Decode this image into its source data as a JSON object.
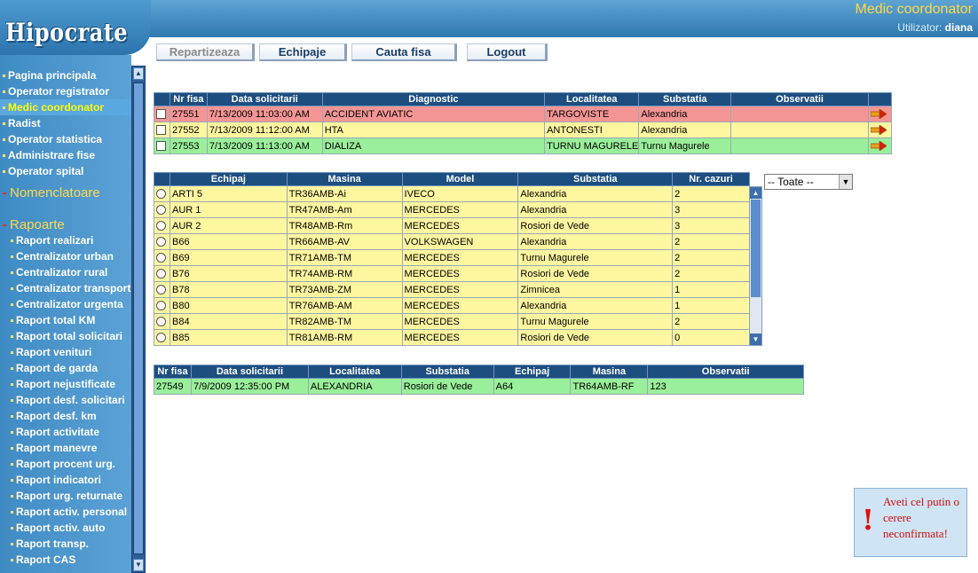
{
  "app": {
    "logo": "Hipocrate",
    "role": "Medic coordonator",
    "user_label": "Utilizator:",
    "user_name": "diana"
  },
  "toolbar": {
    "repartizeaza": "Repartizeaza",
    "echipaje": "Echipaje",
    "cauta_fisa": "Cauta fisa",
    "logout": "Logout"
  },
  "sidebar": {
    "items": [
      "Pagina principala",
      "Operator registrator",
      "Medic coordonator",
      "Radist",
      "Operator statistica",
      "Administrare fise",
      "Operator spital"
    ],
    "active_index": 2,
    "section_nomenclatoare": "Nomenclatoare",
    "section_rapoarte": "Rapoarte",
    "reports": [
      "Raport realizari",
      "Centralizator urban",
      "Centralizator rural",
      "Centralizator transport",
      "Centralizator urgenta",
      "Raport total KM",
      "Raport total solicitari",
      "Raport venituri",
      "Raport de garda",
      "Raport nejustificate",
      "Raport desf. solicitari",
      "Raport desf. km",
      "Raport activitate",
      "Raport manevre",
      "Raport procent urg.",
      "Raport indicatori",
      "Raport urg. returnate",
      "Raport activ. personal",
      "Raport activ. auto",
      "Raport transp.",
      "Raport CAS"
    ]
  },
  "requests": {
    "headers": [
      "",
      "Nr fisa",
      "Data solicitarii",
      "Diagnostic",
      "Localitatea",
      "Substatia",
      "Observatii",
      ""
    ],
    "rows": [
      {
        "nr": "27551",
        "data": "7/13/2009 11:03:00 AM",
        "diag": "ACCIDENT AVIATIC",
        "loc": "TARGOVISTE",
        "sub": "Alexandria",
        "obs": "",
        "color": "#f49595"
      },
      {
        "nr": "27552",
        "data": "7/13/2009 11:12:00 AM",
        "diag": "HTA",
        "loc": "ANTONESTI",
        "sub": "Alexandria",
        "obs": "",
        "color": "#fff6a0"
      },
      {
        "nr": "27553",
        "data": "7/13/2009 11:13:00 AM",
        "diag": "DIALIZA",
        "loc": "TURNU MAGURELE",
        "sub": "Turnu Magurele",
        "obs": "",
        "color": "#9aef9a"
      }
    ]
  },
  "crews": {
    "headers": [
      "",
      "Echipaj",
      "Masina",
      "Model",
      "Substatia",
      "Nr. cazuri"
    ],
    "filter_value": "-- Toate --",
    "rows": [
      {
        "echipaj": "ARTI 5",
        "masina": "TR36AMB-Ai",
        "model": "IVECO",
        "sub": "Alexandria",
        "nr": "2"
      },
      {
        "echipaj": "AUR 1",
        "masina": "TR47AMB-Am",
        "model": "MERCEDES",
        "sub": "Alexandria",
        "nr": "3"
      },
      {
        "echipaj": "AUR 2",
        "masina": "TR48AMB-Rm",
        "model": "MERCEDES",
        "sub": "Rosiori de Vede",
        "nr": "3"
      },
      {
        "echipaj": "B66",
        "masina": "TR66AMB-AV",
        "model": "VOLKSWAGEN",
        "sub": "Alexandria",
        "nr": "2"
      },
      {
        "echipaj": "B69",
        "masina": "TR71AMB-TM",
        "model": "MERCEDES",
        "sub": "Turnu Magurele",
        "nr": "2"
      },
      {
        "echipaj": "B76",
        "masina": "TR74AMB-RM",
        "model": "MERCEDES",
        "sub": "Rosiori de Vede",
        "nr": "2"
      },
      {
        "echipaj": "B78",
        "masina": "TR73AMB-ZM",
        "model": "MERCEDES",
        "sub": "Zimnicea",
        "nr": "1"
      },
      {
        "echipaj": "B80",
        "masina": "TR76AMB-AM",
        "model": "MERCEDES",
        "sub": "Alexandria",
        "nr": "1"
      },
      {
        "echipaj": "B84",
        "masina": "TR82AMB-TM",
        "model": "MERCEDES",
        "sub": "Turnu Magurele",
        "nr": "2"
      },
      {
        "echipaj": "B85",
        "masina": "TR81AMB-RM",
        "model": "MERCEDES",
        "sub": "Rosiori de Vede",
        "nr": "0"
      }
    ]
  },
  "assigned": {
    "headers": [
      "Nr fisa",
      "Data solicitarii",
      "Localitatea",
      "Substatia",
      "Echipaj",
      "Masina",
      "Observatii"
    ],
    "rows": [
      {
        "nr": "27549",
        "data": "7/9/2009 12:35:00 PM",
        "loc": "ALEXANDRIA",
        "sub": "Rosiori de Vede",
        "echipaj": "A64",
        "masina": "TR64AMB-RF",
        "obs": "123"
      }
    ]
  },
  "alert": {
    "message": "Aveti cel putin o cerere neconfirmata!"
  },
  "icons": {
    "sidebar_up": "scroll-up-arrow-icon",
    "sidebar_down": "scroll-down-arrow-icon",
    "row_action": "arrow-right-icon",
    "alert": "exclamation-icon"
  }
}
